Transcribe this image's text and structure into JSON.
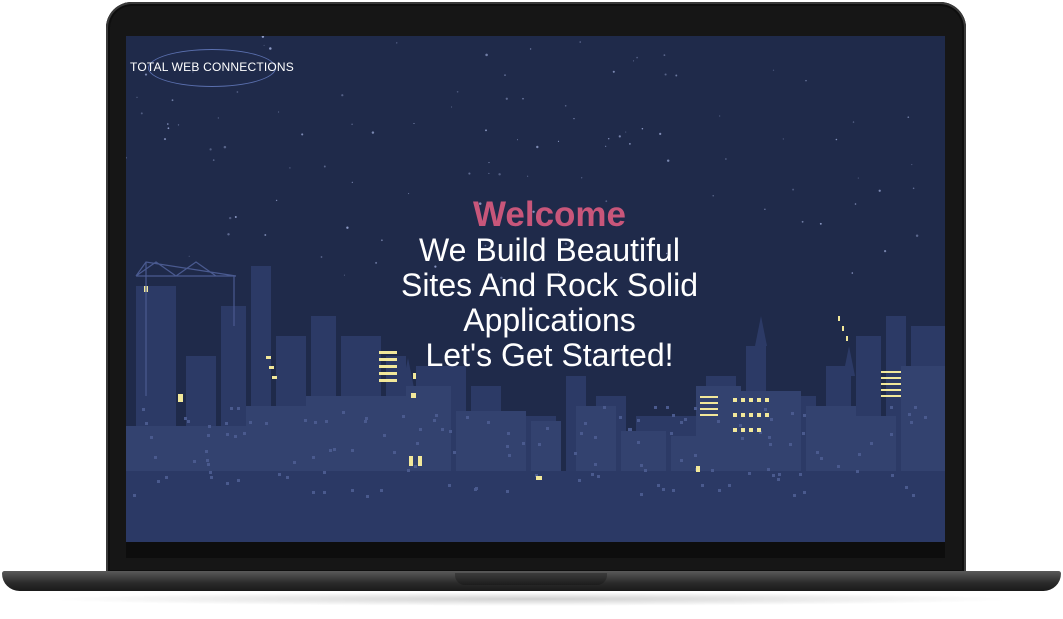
{
  "brand": {
    "logo_text": "TOTAL WEB CONNECTIONS"
  },
  "hero": {
    "welcome": "Welcome",
    "lines": [
      "We Build Beautiful",
      "Sites And Rock Solid",
      "Applications",
      "Let's Get Started!"
    ]
  },
  "colors": {
    "sky": "#1f2a4a",
    "city": "#2c3a66",
    "welcome_accent": "#c8567a",
    "window_light": "#f2e89a"
  }
}
